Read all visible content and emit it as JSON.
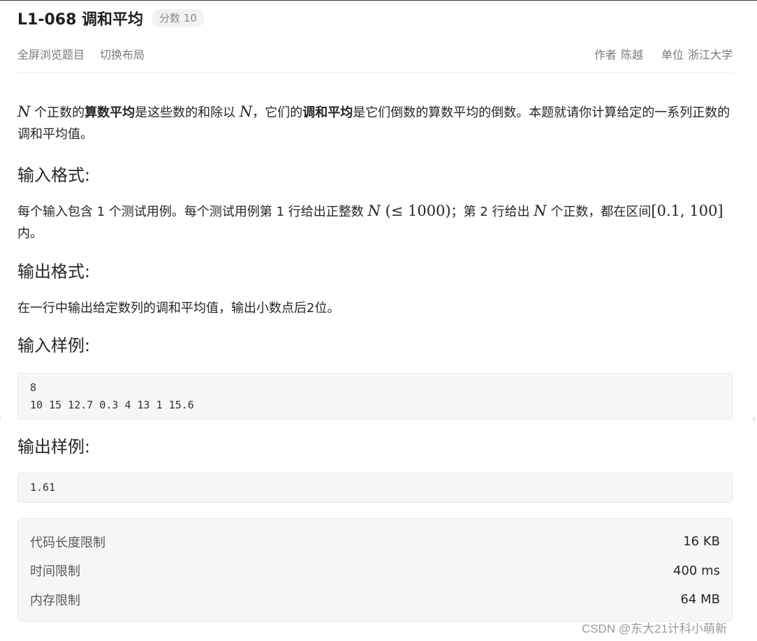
{
  "header": {
    "title": "L1-068 调和平均",
    "score_badge": "分数 10"
  },
  "actions": {
    "fullscreen": "全屏浏览题目",
    "switch_layout": "切换布局"
  },
  "meta": {
    "author_label": "作者",
    "author": "陈越",
    "unit_label": "单位",
    "unit": "浙江大学"
  },
  "statement": {
    "p1_var": "N",
    "p1_t1": " 个正数的",
    "p1_b1": "算数平均",
    "p1_t2": "是这些数的和除以 ",
    "p1_var2": "N",
    "p1_t3": "，它们的",
    "p1_b2": "调和平均",
    "p1_t4": "是它们倒数的算数平均的倒数。本题就请你计算给定的一系列正数的调和平均值。"
  },
  "input_format": {
    "heading": "输入格式:",
    "t1": "每个输入包含 1 个测试用例。每个测试用例第 1 行给出正整数 ",
    "var_n": "N",
    "constraint": " (≤ 1000)",
    "t2": "；第 2 行给出 ",
    "var_n2": "N",
    "t3": " 个正数，都在区间",
    "interval": "[0.1, 100]",
    "t4": " 内。"
  },
  "output_format": {
    "heading": "输出格式:",
    "text": "在一行中输出给定数列的调和平均值，输出小数点后2位。"
  },
  "sample_input": {
    "heading": "输入样例:",
    "code": "8\n10 15 12.7 0.3 4 13 1 15.6"
  },
  "sample_output": {
    "heading": "输出样例:",
    "code": "1.61"
  },
  "limits": [
    {
      "label": "代码长度限制",
      "value": "16 KB"
    },
    {
      "label": "时间限制",
      "value": "400 ms"
    },
    {
      "label": "内存限制",
      "value": "64 MB"
    }
  ],
  "watermark": "CSDN @东大21计科小萌新",
  "icons": {
    "edge_left": "chevron-left-icon",
    "edge_right": "chevron-right-icon"
  }
}
